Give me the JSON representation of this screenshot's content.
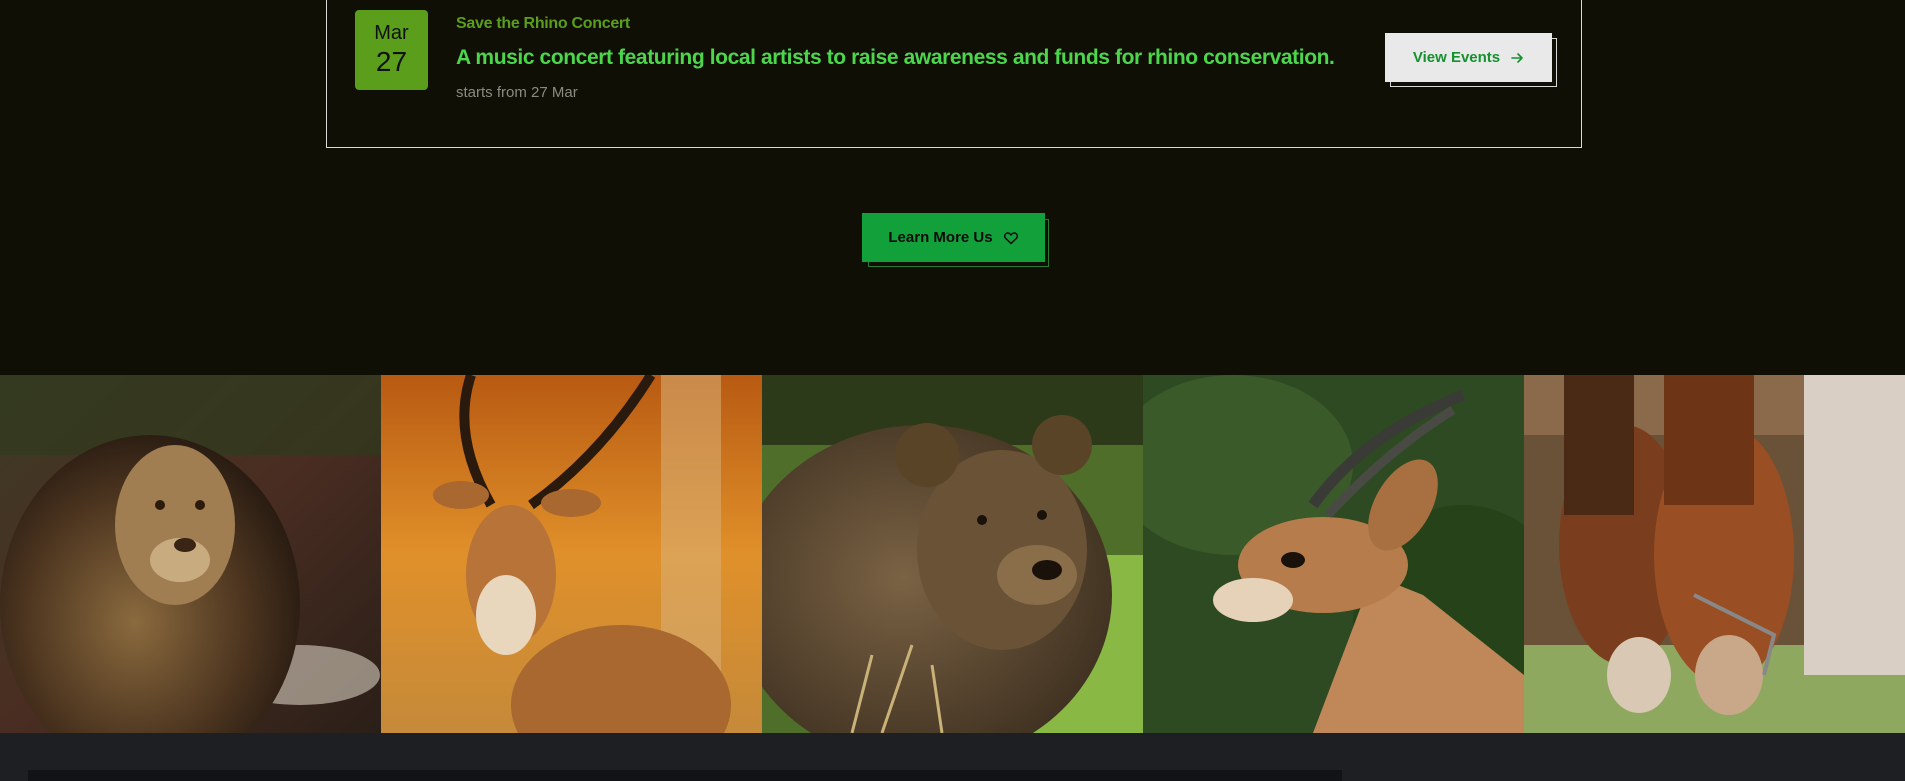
{
  "event": {
    "month": "Mar",
    "day": "27",
    "label": "Save the Rhino Concert",
    "title": "A music concert featuring local artists to raise awareness and funds for rhino conservation.",
    "starts": "starts from 27 Mar",
    "button_label": "View Events",
    "button_icon": "arrow-right-icon"
  },
  "cta": {
    "label": "Learn More Us",
    "icon": "heart-icon"
  },
  "gallery": {
    "images": [
      "lion",
      "impala",
      "brown-bear",
      "antelope",
      "horses"
    ]
  },
  "colors": {
    "background": "#100f05",
    "accent_green": "#12a03a",
    "badge_green": "#5a9e1c",
    "title_green": "#4cd64c",
    "footer": "#1e1f23"
  }
}
